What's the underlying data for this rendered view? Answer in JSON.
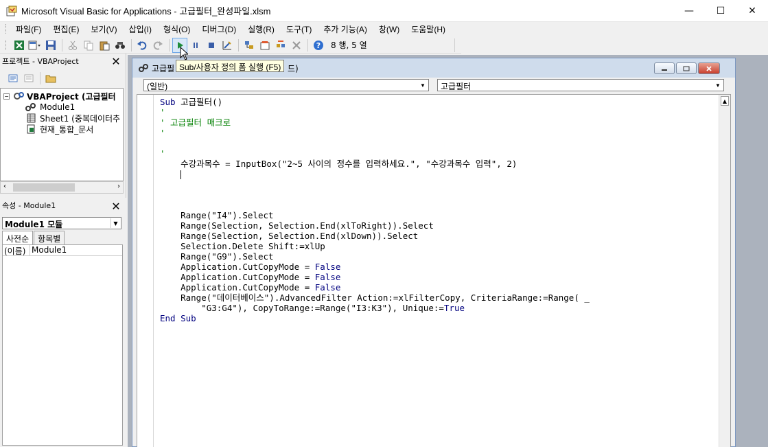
{
  "window": {
    "title": "Microsoft Visual Basic for Applications - 고급필터_완성파일.xlsm",
    "minimize": "—",
    "maximize": "☐",
    "close": "✕"
  },
  "menu": [
    "파일(F)",
    "편집(E)",
    "보기(V)",
    "삽입(I)",
    "형식(O)",
    "디버그(D)",
    "실행(R)",
    "도구(T)",
    "추가 기능(A)",
    "창(W)",
    "도움말(H)"
  ],
  "toolbar": {
    "position_label": "8 행, 5 열",
    "tooltip": "Sub/사용자 정의 폼 실행 (F5)"
  },
  "project_panel": {
    "title": "프로젝트 - VBAProject",
    "close": "✕",
    "tree": {
      "root": "VBAProject (고급필터",
      "module": "Module1",
      "sheet": "Sheet1 (중복데이터추",
      "workbook": "현재_통합_문서"
    }
  },
  "properties_panel": {
    "title": "속성 - Module1",
    "close": "✕",
    "object_select": "Module1 모듈",
    "tabs": [
      "사전순",
      "항목별"
    ],
    "rows": [
      {
        "name": "(이름)",
        "value": "Module1"
      }
    ]
  },
  "code_window": {
    "title_start": "고급필",
    "title_end": "드)",
    "object_combo": "(일반)",
    "procedure_combo": "고급필터",
    "lines": {
      "l1_kw": "Sub",
      "l1_rest": " 고급필터()",
      "l2": "'",
      "l3": "' 고급필터 매크로",
      "l4": "'",
      "l5": "",
      "l6": "'",
      "l7": "    수강과목수 = InputBox(\"2~5 사이의 정수를 입력하세요.\", \"수강과목수 입력\", 2)",
      "l12": "    Range(\"I4\").Select",
      "l13": "    Range(Selection, Selection.End(xlToRight)).Select",
      "l14": "    Range(Selection, Selection.End(xlDown)).Select",
      "l15": "    Selection.Delete Shift:=xlUp",
      "l16": "    Range(\"G9\").Select",
      "l17_pre": "    Application.CutCopyMode = ",
      "l17_kw": "False",
      "l18_pre": "    Application.CutCopyMode = ",
      "l18_kw": "False",
      "l19_pre": "    Application.CutCopyMode = ",
      "l19_kw": "False",
      "l20": "    Range(\"데이터베이스\").AdvancedFilter Action:=xlFilterCopy, CriteriaRange:=Range( _",
      "l21_pre": "        \"G3:G4\"), CopyToRange:=Range(\"I3:K3\"), Unique:=",
      "l21_kw": "True",
      "l22_kw1": "End",
      "l22_kw2": "Sub"
    }
  },
  "colors": {
    "keyword": "#00007f",
    "comment": "#007f00",
    "mdi_background": "#abb2bd",
    "tooltip_background": "#ffffe1"
  }
}
